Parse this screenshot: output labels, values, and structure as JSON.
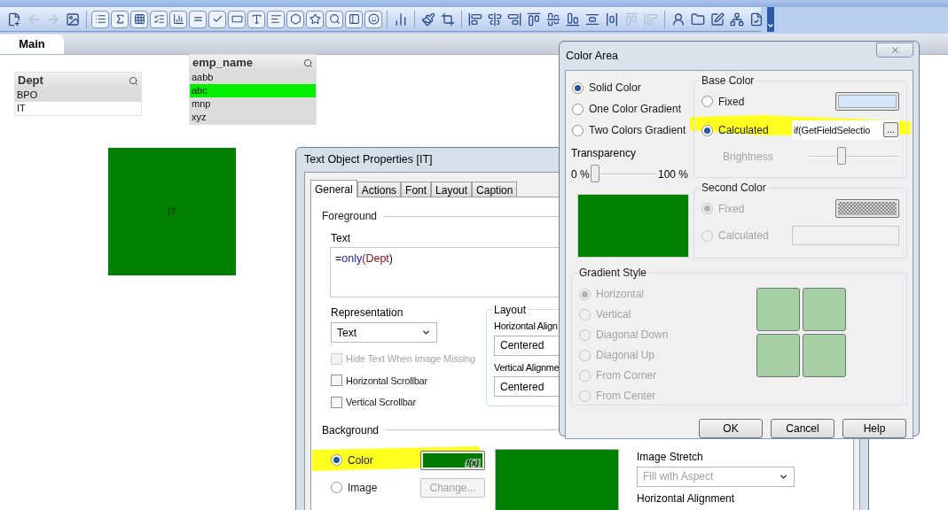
{
  "sheet_tabs": [
    {
      "label": "Main",
      "selected": true
    }
  ],
  "list_boxes": [
    {
      "title": "Dept",
      "items": [
        {
          "label": "BPO",
          "selected": false,
          "excluded": true
        },
        {
          "label": "IT",
          "selected": false,
          "excluded": false
        }
      ]
    },
    {
      "title": "emp_name",
      "items": [
        {
          "label": "aabb",
          "selected": false,
          "excluded": true
        },
        {
          "label": "abc",
          "selected": true,
          "excluded": false
        },
        {
          "label": "mnp",
          "selected": false,
          "excluded": true
        },
        {
          "label": "xyz",
          "selected": false,
          "excluded": true
        }
      ]
    }
  ],
  "text_object": {
    "text": "IT"
  },
  "text_dialog": {
    "title": "Text Object Properties [IT]",
    "tabs": [
      {
        "label": "General",
        "selected": true
      },
      {
        "label": "Actions",
        "selected": false
      },
      {
        "label": "Font",
        "selected": false
      },
      {
        "label": "Layout",
        "selected": false
      },
      {
        "label": "Caption",
        "selected": false
      }
    ],
    "foreground_heading": "Foreground",
    "text_label": "Text",
    "expression": [
      {
        "text": "=",
        "kind": "operator"
      },
      {
        "text": "only",
        "kind": "function"
      },
      {
        "text": "(Dept",
        "kind": "field"
      },
      {
        "text": ")",
        "kind": "operator"
      }
    ],
    "representation_label": "Representation",
    "representation_value": "Text",
    "checkboxes": [
      {
        "label": "Hide Text When Image Missing",
        "checked": false,
        "disabled": true
      },
      {
        "label": "Horizontal Scrollbar",
        "checked": false,
        "disabled": false
      },
      {
        "label": "Vertical Scrollbar",
        "checked": false,
        "disabled": false
      }
    ],
    "layout_group": {
      "title": "Layout",
      "horizontal_label": "Horizontal Align",
      "horizontal_value": "Centered",
      "vertical_label": "Vertical Alignme",
      "vertical_value": "Centered"
    },
    "background_heading": "Background",
    "background_options": [
      {
        "label": "Color",
        "selected": true
      },
      {
        "label": "Image",
        "selected": false
      }
    ],
    "formula_badge": "f(x)",
    "change_button": {
      "label": "Change...",
      "disabled": true
    },
    "image_stretch_label": "Image Stretch",
    "image_stretch_value": "Fill with Aspect",
    "horizontal_alignment_label": "Horizontal Alignment"
  },
  "color_dialog": {
    "title": "Color Area",
    "modes": [
      {
        "label": "Solid Color",
        "selected": true
      },
      {
        "label": "One Color Gradient",
        "selected": false
      },
      {
        "label": "Two Colors Gradient",
        "selected": false
      }
    ],
    "transparency_label": "Transparency",
    "transparency_min": "0 %",
    "transparency_max": "100 %",
    "transparency": {
      "level": 0
    },
    "base_color": {
      "title": "Base Color",
      "options": [
        {
          "label": "Fixed",
          "selected": false
        },
        {
          "label": "Calculated",
          "selected": true
        }
      ],
      "expression": "if(GetFieldSelectio",
      "browse": "...",
      "brightness_label": "Brightness",
      "brightness": {
        "level": 0.35
      }
    },
    "second_color": {
      "title": "Second Color",
      "disabled": true,
      "options": [
        {
          "label": "Fixed",
          "selected": true
        },
        {
          "label": "Calculated",
          "selected": false
        }
      ]
    },
    "gradient_style": {
      "title": "Gradient Style",
      "disabled": true,
      "options": [
        {
          "label": "Horizontal",
          "selected": true
        },
        {
          "label": "Vertical",
          "selected": false
        },
        {
          "label": "Diagonal Down",
          "selected": false
        },
        {
          "label": "Diagonal Up",
          "selected": false
        },
        {
          "label": "From Corner",
          "selected": false
        },
        {
          "label": "From Center",
          "selected": false
        }
      ]
    },
    "buttons": [
      "OK",
      "Cancel",
      "Help"
    ]
  }
}
